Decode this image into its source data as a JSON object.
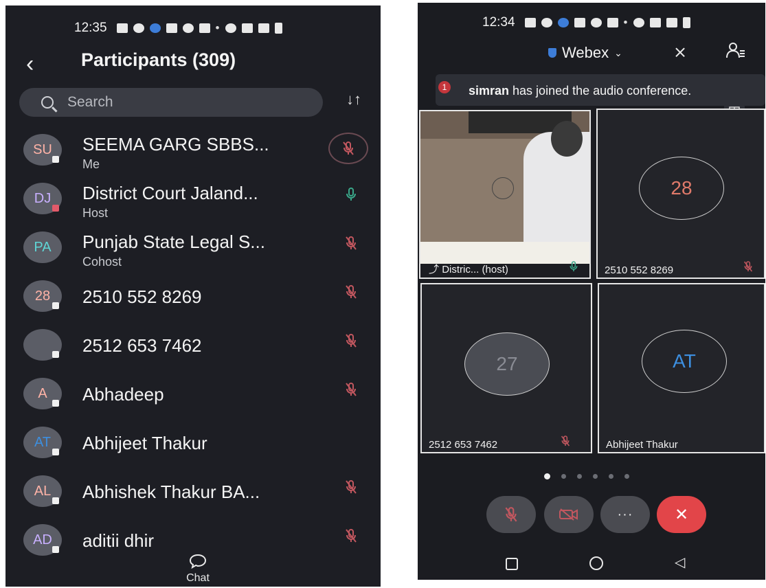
{
  "left": {
    "status_time": "12:35",
    "title": "Participants (309)",
    "search_placeholder": "Search",
    "participants": [
      {
        "initials": "SU",
        "name": "SEEMA GARG SBBS...",
        "role": "Me"
      },
      {
        "initials": "DJ",
        "name": "District Court Jaland...",
        "role": "Host"
      },
      {
        "initials": "PA",
        "name": "Punjab State Legal S...",
        "role": "Cohost"
      },
      {
        "initials": "28",
        "name": "2510 552 8269",
        "role": ""
      },
      {
        "initials": "",
        "name": "2512 653 7462",
        "role": ""
      },
      {
        "initials": "A",
        "name": "Abhadeep",
        "role": ""
      },
      {
        "initials": "AT",
        "name": "Abhijeet Thakur",
        "role": ""
      },
      {
        "initials": "AL",
        "name": "Abhishek Thakur BA...",
        "role": ""
      },
      {
        "initials": "AD",
        "name": "aditii dhir",
        "role": ""
      }
    ],
    "chat_label": "Chat"
  },
  "right": {
    "status_time": "12:34",
    "app_name": "Webex",
    "toast_badge": "1",
    "toast_user": "simran",
    "toast_text": " has joined the audio conference.",
    "tiles": [
      {
        "label": "Distric... (host)",
        "avatar": ""
      },
      {
        "label": "2510 552 8269",
        "avatar": "28"
      },
      {
        "label": "2512 653 7462",
        "avatar": "27"
      },
      {
        "label": "Abhijeet Thakur",
        "avatar": "AT"
      }
    ],
    "more_label": "···",
    "end_label": "✕"
  },
  "colors": {
    "background": "#1d1e24",
    "muted_mic": "#c2575f",
    "active_mic": "#3aa88a",
    "end_call": "#e24549",
    "avatar_blue": "#3d8fe0"
  }
}
